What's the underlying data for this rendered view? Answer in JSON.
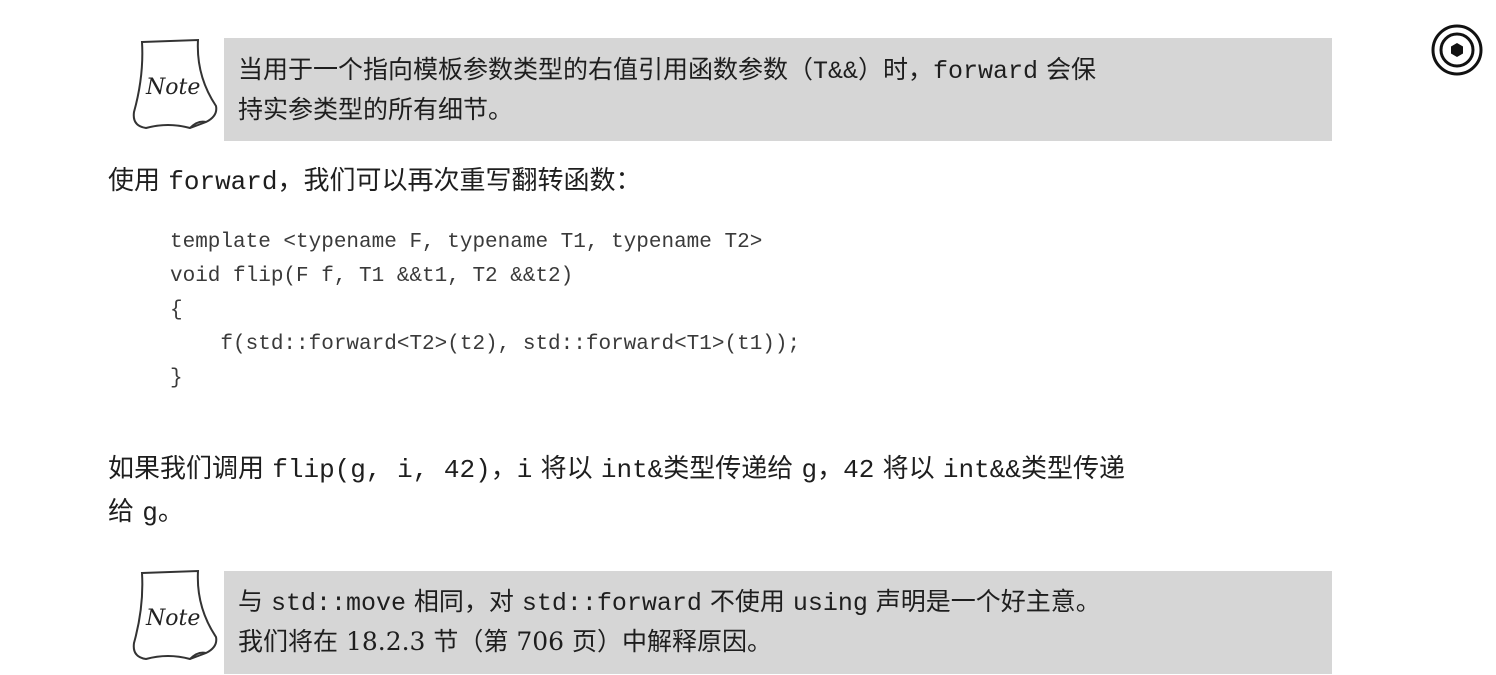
{
  "note1": {
    "icon_label": "Note",
    "line1_a": "当用于一个指向模板参数类型的右值引用函数参数（",
    "line1_code": "T&&",
    "line1_b": "）时，",
    "line1_code2": "forward",
    "line1_c": " 会保",
    "line2": "持实参类型的所有细节。"
  },
  "para1": {
    "a": "使用 ",
    "code": "forward",
    "b": "，我们可以再次重写翻转函数："
  },
  "code": {
    "lines": [
      "template <typename F, typename T1, typename T2>",
      "void flip(F f, T1 &&t1, T2 &&t2)",
      "{",
      "    f(std::forward<T2>(t2), std::forward<T1>(t1));",
      "}"
    ]
  },
  "para2": {
    "a": "如果我们调用 ",
    "code1": "flip(g, i, 42)",
    "b": "，",
    "code2": "i",
    "c": " 将以 ",
    "code3": "int&",
    "d": "类型传递给 ",
    "code4": "g",
    "e": "，",
    "code5": "42",
    "f": " 将以 ",
    "code6": "int&&",
    "g": "类型传递",
    "line2_a": "给 ",
    "line2_code": "g",
    "line2_b": "。"
  },
  "note2": {
    "icon_label": "Note",
    "line1_a": "与 ",
    "line1_code": "std::move",
    "line1_b": " 相同，对 ",
    "line1_code2": "std::forward",
    "line1_c": " 不使用 ",
    "line1_code3": "using",
    "line1_d": " 声明是一个好主意。",
    "line2": "我们将在 18.2.3 节（第 706 页）中解释原因。"
  },
  "corner_button": {
    "icon": "target-icon"
  }
}
